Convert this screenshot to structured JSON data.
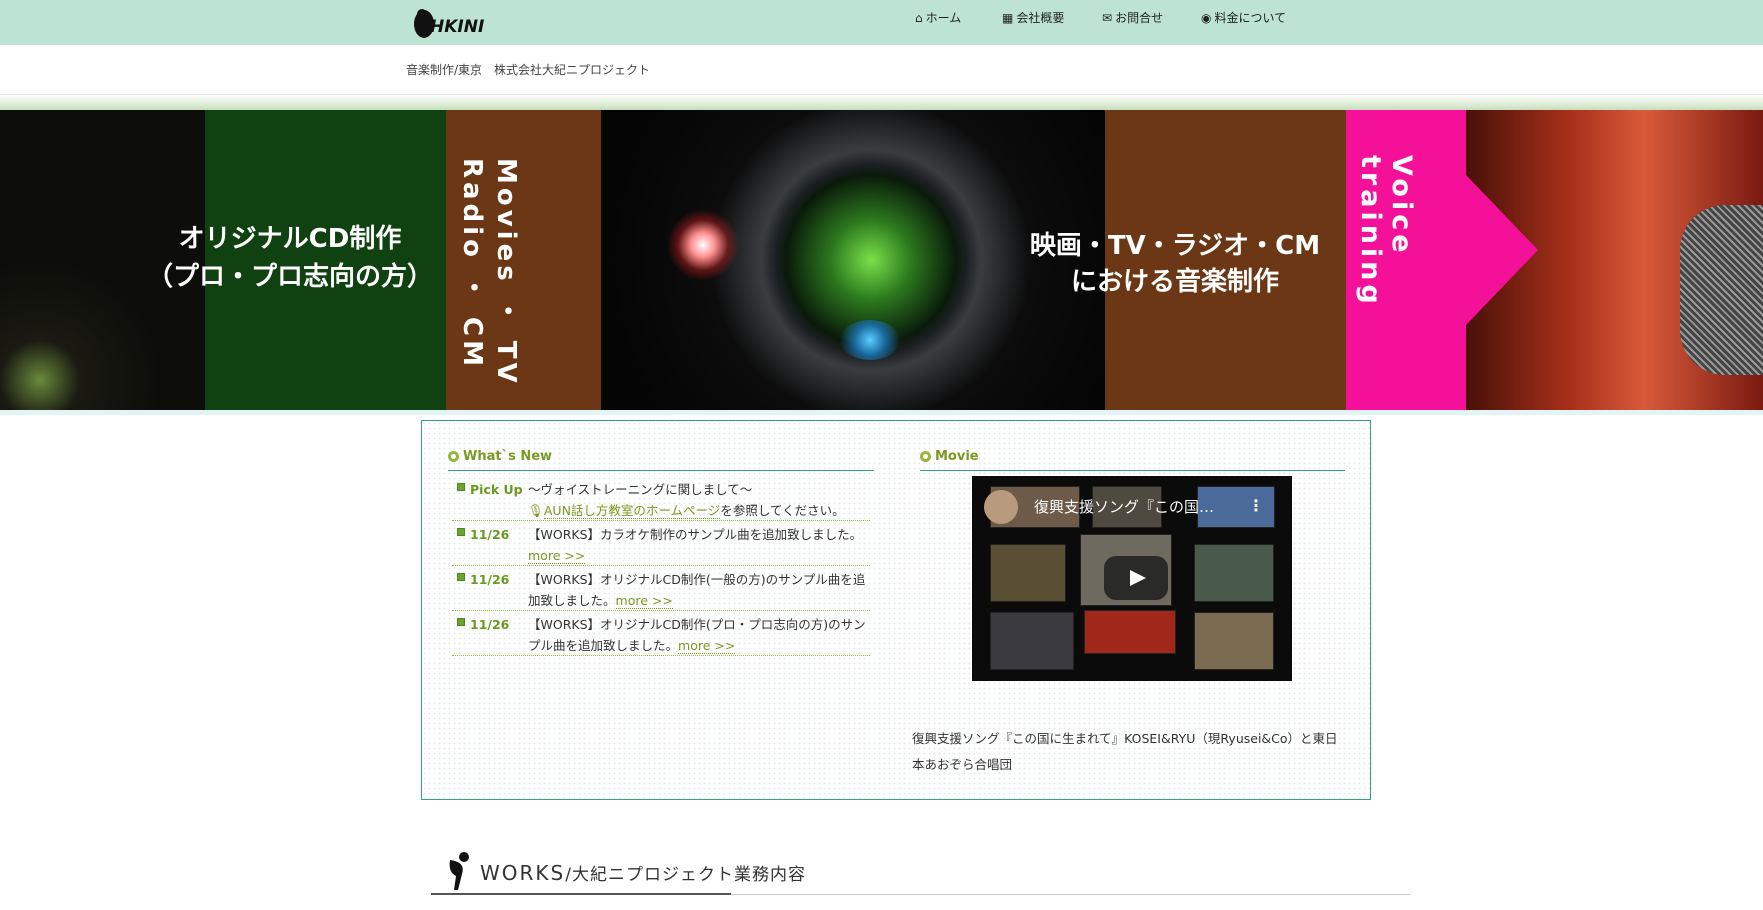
{
  "header": {
    "logo_text": "OHKINI",
    "nav": [
      {
        "icon": "home-icon",
        "glyph": "⌂",
        "label": "ホーム"
      },
      {
        "icon": "building-icon",
        "glyph": "▦",
        "label": "会社概要"
      },
      {
        "icon": "mail-icon",
        "glyph": "✉",
        "label": "お問合せ"
      },
      {
        "icon": "coin-icon",
        "glyph": "◉",
        "label": "料金について"
      }
    ],
    "tagline": "音楽制作/東京　株式会社大紀ニプロジェクト"
  },
  "hero": {
    "panel1": "オリジナルCD制作\n（プロ・プロ志向の方）",
    "panel2": "Movies ・ TV\nRadio ・ CM",
    "panel3": "映画・TV・ラジオ・CM\nにおける音楽制作",
    "panel4": "Voice training"
  },
  "whats_new": {
    "title": "What`s New",
    "items": [
      {
        "date": "Pick Up",
        "text": "〜ヴォイストレーニングに関しまして〜",
        "link": "AUN話し方教室のホームページ",
        "after": "を参照してください。"
      },
      {
        "date": "11/26",
        "text": "【WORKS】カラオケ制作のサンプル曲を追加致しました。",
        "more": "more >>"
      },
      {
        "date": "11/26",
        "text": "【WORKS】オリジナルCD制作(一般の方)のサンプル曲を追加致しました。",
        "more": "more >>"
      },
      {
        "date": "11/26",
        "text": "【WORKS】オリジナルCD制作(プロ・プロ志向の方)のサンプル曲を追加致しました。",
        "more": "more >>"
      }
    ]
  },
  "movie": {
    "title": "Movie",
    "video_title": "復興支援ソング『この国…",
    "caption": "復興支援ソング『この国に生まれて』KOSEI&RYU（現Ryusei&Co）と東日本あおぞら合唱団"
  },
  "works": {
    "title": "WORKS",
    "subtitle": "/大紀ニプロジェクト業務内容"
  },
  "colors": {
    "topbar": "#bde3d3",
    "accent_green": "#37a37a",
    "olive": "#7a9a22",
    "pink": "#f5109a",
    "brown": "#6b3714",
    "dark_green": "#0f4210"
  }
}
